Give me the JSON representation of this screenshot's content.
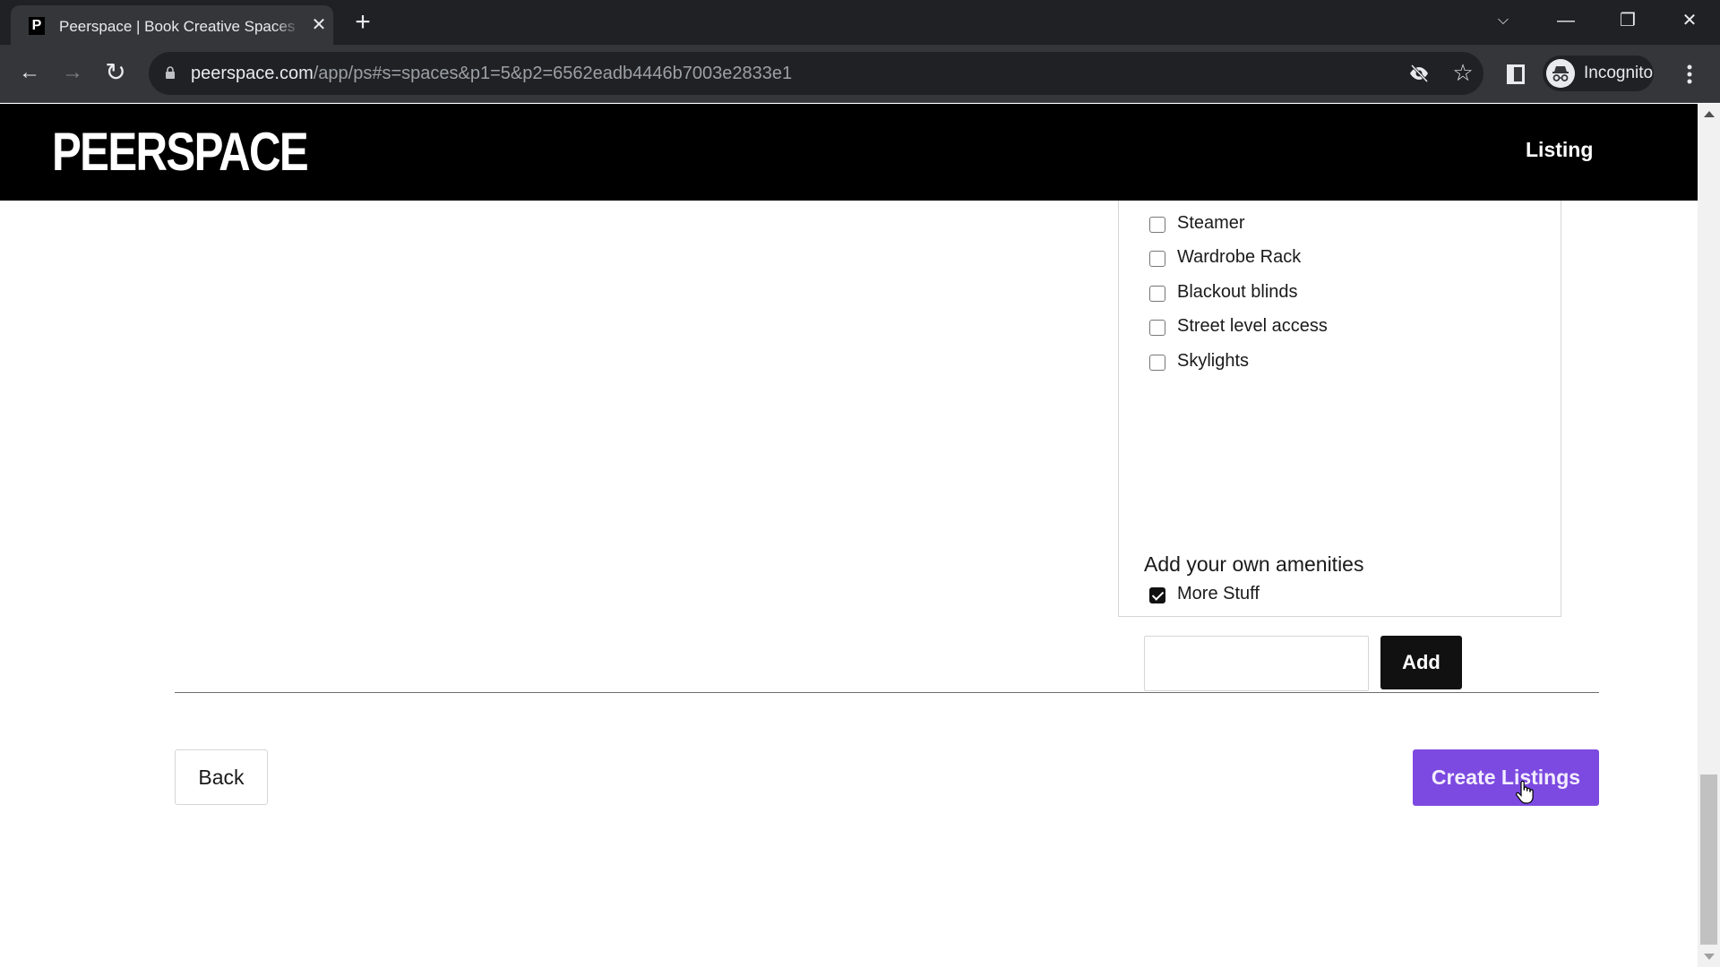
{
  "browser": {
    "tab": {
      "favicon_letter": "P",
      "title": "Peerspace | Book Creative Spaces",
      "close_glyph": "✕"
    },
    "new_tab_glyph": "+",
    "window_controls": {
      "tab_search_glyph": "⌵",
      "minimize_glyph": "—",
      "restore_glyph": "❐",
      "close_glyph": "✕"
    },
    "nav": {
      "back_glyph": "←",
      "forward_glyph": "→",
      "reload_glyph": "↻"
    },
    "url": {
      "host": "peerspace.com",
      "path": "/app/ps#s=spaces&p1=5&p2=6562eadb4446b7003e2833e1"
    },
    "bookmark_glyph": "☆",
    "profile_label": "Incognito"
  },
  "site": {
    "logo": "PEERSPACE",
    "nav_item": "Listing"
  },
  "amenities": {
    "items": [
      {
        "label": "Steamer",
        "checked": false
      },
      {
        "label": "Wardrobe Rack",
        "checked": false
      },
      {
        "label": "Blackout blinds",
        "checked": false
      },
      {
        "label": "Street level access",
        "checked": false
      },
      {
        "label": "Skylights",
        "checked": false
      }
    ],
    "custom_heading": "Add your own amenities",
    "custom_items": [
      {
        "label": "More Stuff",
        "checked": true
      }
    ],
    "input_value": "",
    "add_label": "Add"
  },
  "footer": {
    "back_label": "Back",
    "create_label": "Create Listings"
  },
  "colors": {
    "accent": "#7c4ae0",
    "header_bg": "#000000",
    "button_dark": "#111111"
  }
}
